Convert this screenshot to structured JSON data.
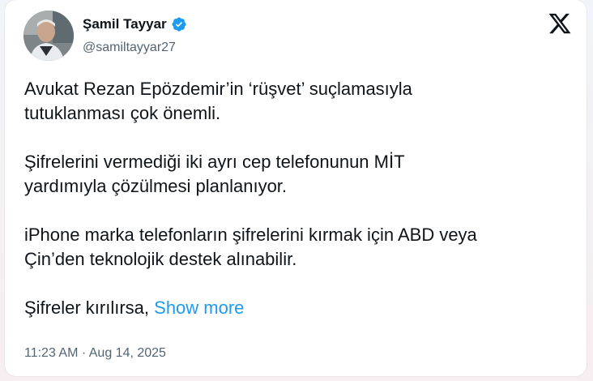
{
  "author": {
    "name": "Şamil Tayyar",
    "handle": "@samiltayyar27",
    "verified": true
  },
  "tweet": {
    "paragraphs": [
      "Avukat Rezan Epözdemir’in ‘rüşvet’ suçlamasıyla\ntutuklanması çok önemli.",
      "Şifrelerini vermediği iki ayrı cep telefonunun MİT\nyardımıyla çözülmesi planlanıyor.",
      "iPhone marka telefonların şifrelerini kırmak için ABD veya\nÇin’den teknolojik destek alınabilir."
    ],
    "truncated_text": "Şifreler kırılırsa, ",
    "show_more_label": "Show more",
    "timestamp": "11:23 AM · Aug 14, 2025"
  },
  "icons": {
    "verified": "verified-badge-icon",
    "platform_logo": "x-logo-icon"
  },
  "colors": {
    "text": "#0f1419",
    "secondary": "#536471",
    "link": "#1d9bf0",
    "verified": "#1d9bf0"
  }
}
